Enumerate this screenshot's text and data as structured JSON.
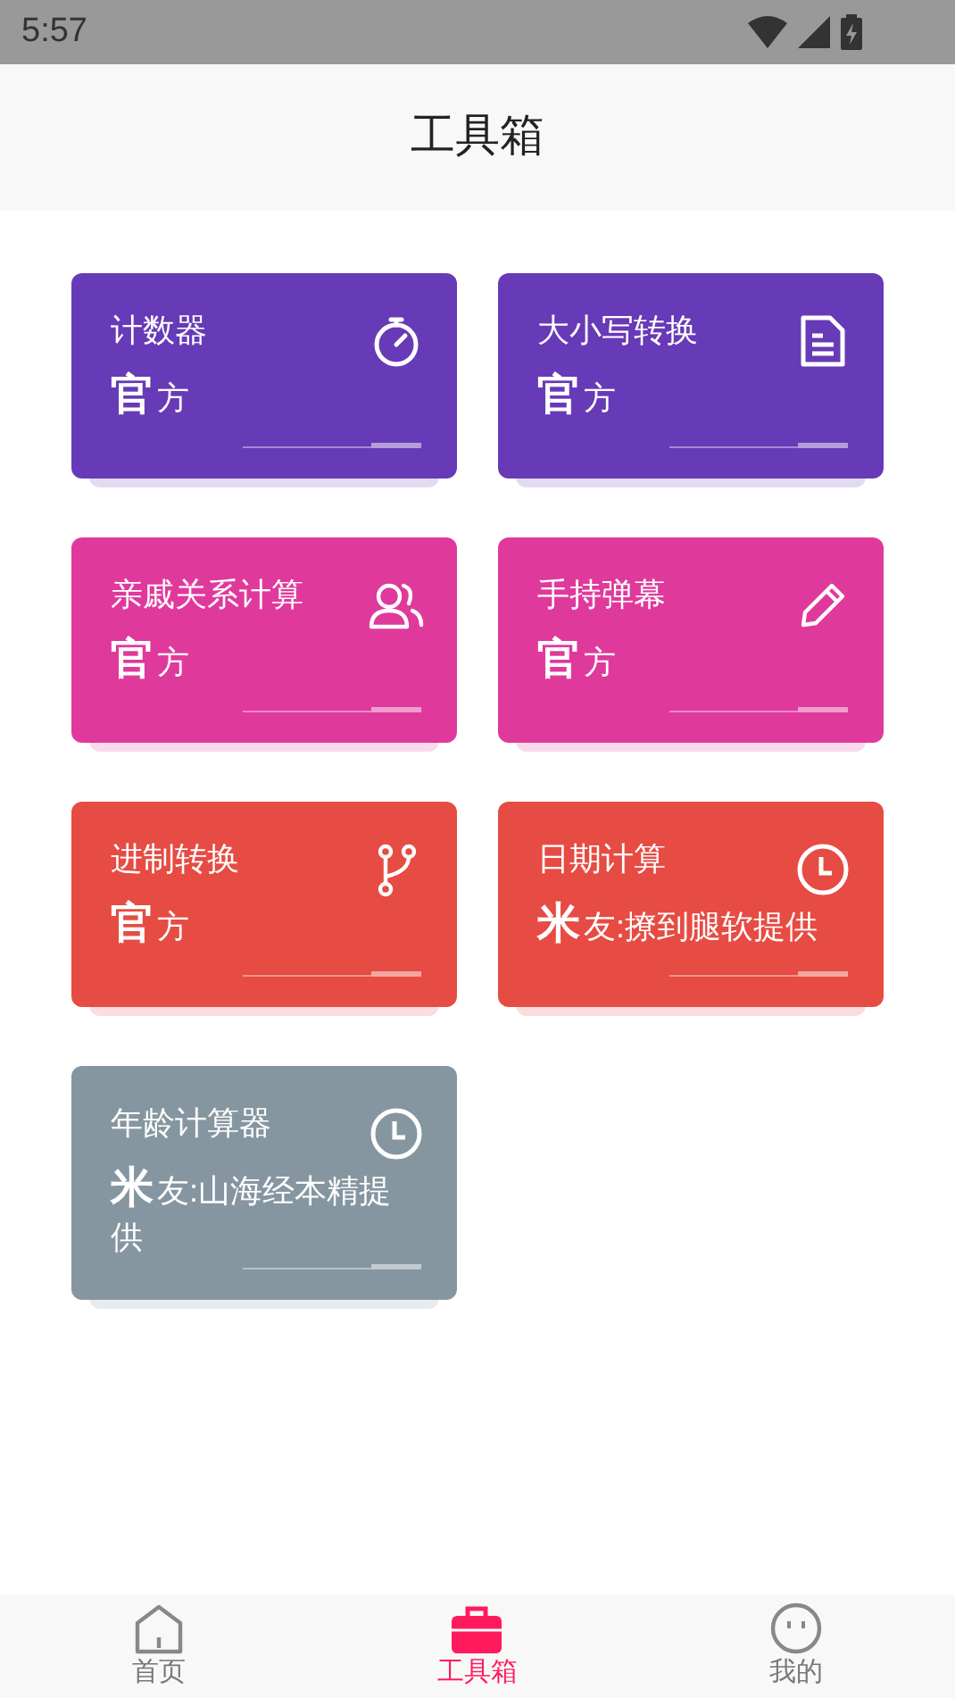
{
  "status_bar": {
    "time": "5:57"
  },
  "header": {
    "title": "工具箱"
  },
  "tools": [
    {
      "title": "计数器",
      "kind": "stopwatch",
      "color": "#673ab7",
      "source": {
        "mark": "官",
        "text": "方"
      }
    },
    {
      "title": "大小写转换",
      "kind": "document",
      "color": "#673ab7",
      "source": {
        "mark": "官",
        "text": "方"
      }
    },
    {
      "title": "亲戚关系计算",
      "kind": "people",
      "color": "#e0399c",
      "source": {
        "mark": "官",
        "text": "方"
      }
    },
    {
      "title": "手持弹幕",
      "kind": "pencil",
      "color": "#e0399c",
      "source": {
        "mark": "官",
        "text": "方"
      }
    },
    {
      "title": "进制转换",
      "kind": "branch",
      "color": "#e64c43",
      "source": {
        "mark": "官",
        "text": "方"
      }
    },
    {
      "title": "日期计算",
      "kind": "clock",
      "color": "#e64c43",
      "source": {
        "mark": "米",
        "text": "友:撩到腿软提供"
      }
    },
    {
      "title": "年龄计算器",
      "kind": "clock",
      "color": "#8696a0",
      "source": {
        "mark": "米",
        "text": "友:山海经本精提供"
      }
    }
  ],
  "bottom_nav": [
    {
      "label": "首页",
      "kind": "house",
      "selected": false
    },
    {
      "label": "工具箱",
      "kind": "toolbox",
      "selected": true
    },
    {
      "label": "我的",
      "kind": "face",
      "selected": false
    }
  ]
}
